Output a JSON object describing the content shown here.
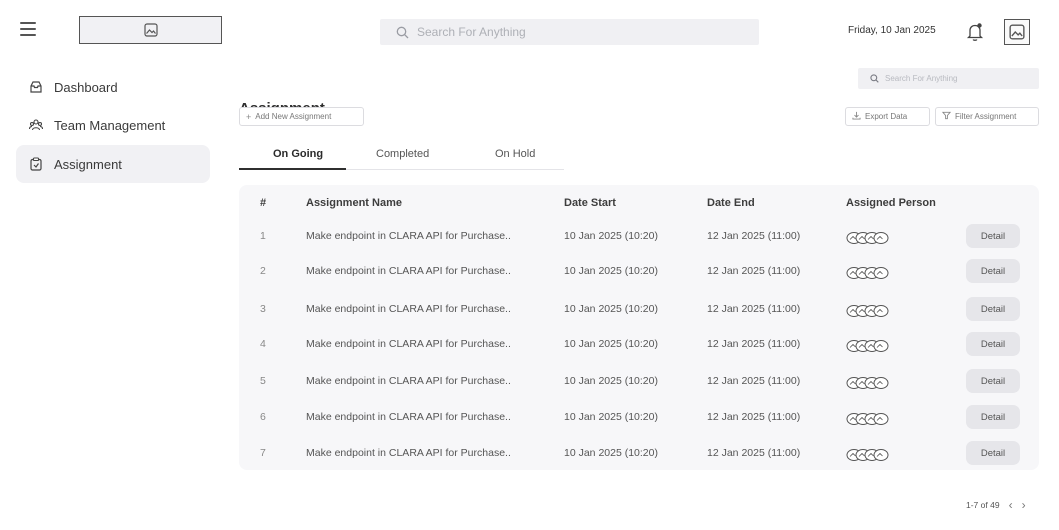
{
  "header": {
    "search_placeholder": "Search For Anything",
    "date": "Friday, 10 Jan 2025"
  },
  "sidebar": {
    "items": [
      {
        "label": "Dashboard",
        "icon": "inbox-icon"
      },
      {
        "label": "Team Management",
        "icon": "team-icon"
      },
      {
        "label": "Assignment",
        "icon": "clipboard-icon",
        "active": true
      }
    ]
  },
  "main": {
    "title": "Assignment",
    "search_placeholder": "Search For Anything",
    "add_button": "Add New Assignment",
    "export_button": "Export Data",
    "filter_button": "Filter Assignment",
    "tabs": [
      "On Going",
      "Completed",
      "On Hold"
    ],
    "active_tab": "On Going"
  },
  "table": {
    "columns": [
      "#",
      "Assignment Name",
      "Date Start",
      "Date End",
      "Assigned Person"
    ],
    "detail_label": "Detail",
    "rows": [
      {
        "num": "1",
        "name": "Make endpoint in CLARA API for Purchase..",
        "start": "10 Jan 2025 (10:20)",
        "end": "12 Jan 2025 (11:00)"
      },
      {
        "num": "2",
        "name": "Make endpoint in CLARA API for Purchase..",
        "start": "10 Jan 2025 (10:20)",
        "end": "12 Jan 2025 (11:00)"
      },
      {
        "num": "3",
        "name": "Make endpoint in CLARA API for Purchase..",
        "start": "10 Jan 2025 (10:20)",
        "end": "12 Jan 2025 (11:00)"
      },
      {
        "num": "4",
        "name": "Make endpoint in CLARA API for Purchase..",
        "start": "10 Jan 2025 (10:20)",
        "end": "12 Jan 2025 (11:00)"
      },
      {
        "num": "5",
        "name": "Make endpoint in CLARA API for Purchase..",
        "start": "10 Jan 2025 (10:20)",
        "end": "12 Jan 2025 (11:00)"
      },
      {
        "num": "6",
        "name": "Make endpoint in CLARA API for Purchase..",
        "start": "10 Jan 2025 (10:20)",
        "end": "12 Jan 2025 (11:00)"
      },
      {
        "num": "7",
        "name": "Make endpoint in CLARA API for Purchase..",
        "start": "10 Jan 2025 (10:20)",
        "end": "12 Jan 2025 (11:00)"
      }
    ]
  },
  "pagination": {
    "range": "1-7",
    "of": "of 49",
    "prev_icon": "chevron-left-icon",
    "next_icon": "chevron-right-icon"
  },
  "colors": {
    "sidebar_active_bg": "#f1f1f4",
    "table_bg": "#f7f7f9",
    "detail_button_bg": "#e6e6ea",
    "tab_underline": "#2f2f2f"
  }
}
